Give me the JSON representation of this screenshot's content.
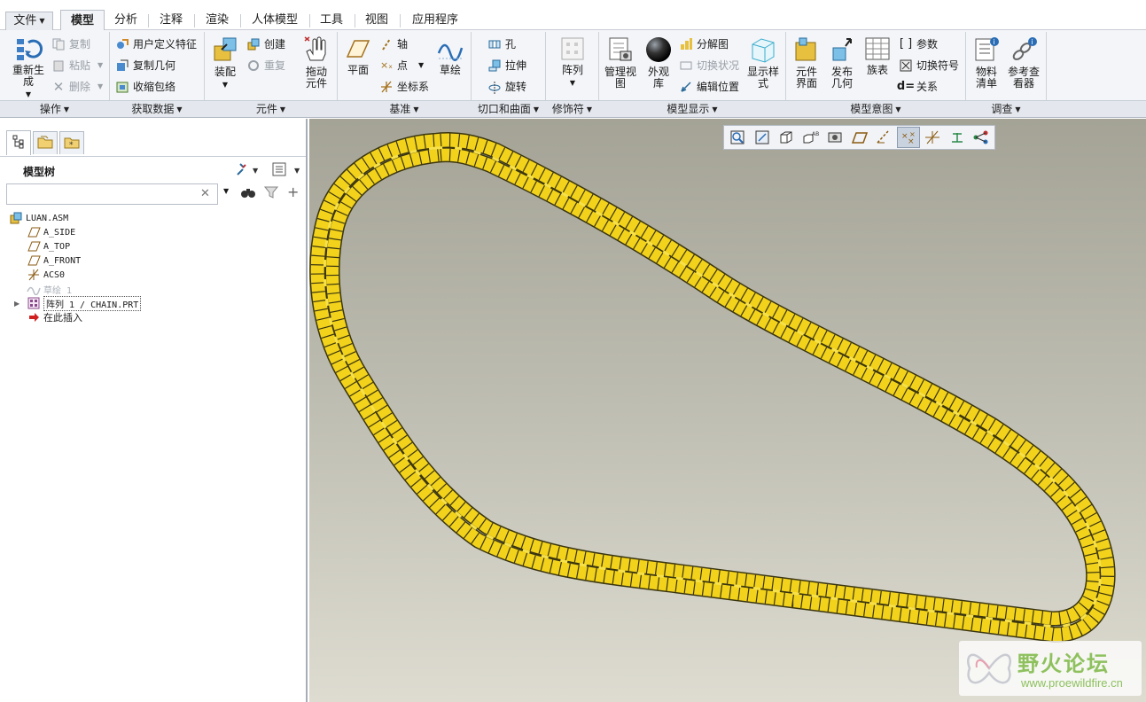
{
  "tabs": [
    {
      "label": "文件",
      "has_caret": true
    },
    {
      "label": "模型",
      "active": true
    },
    {
      "label": "分析"
    },
    {
      "label": "注释"
    },
    {
      "label": "渲染"
    },
    {
      "label": "人体模型"
    },
    {
      "label": "工具"
    },
    {
      "label": "视图"
    },
    {
      "label": "应用程序"
    }
  ],
  "ribbon": {
    "operations": {
      "regenerate": "重新生成",
      "copy": "复制",
      "paste": "粘贴",
      "delete": "删除",
      "group": "操作"
    },
    "get_data": {
      "udf": "用户定义特征",
      "copy_geom": "复制几何",
      "shrinkwrap": "收缩包络",
      "group": "获取数据"
    },
    "component": {
      "assemble": "装配",
      "create": "创建",
      "repeat": "重复",
      "drag": "拖动元件",
      "group": "元件"
    },
    "datum": {
      "plane": "平面",
      "axis": "轴",
      "point": "点",
      "csys": "坐标系",
      "sketch": "草绘",
      "group": "基准"
    },
    "cut_surface": {
      "hole": "孔",
      "extrude": "拉伸",
      "revolve": "旋转",
      "group": "切口和曲面"
    },
    "modifiers": {
      "pattern": "阵列",
      "group": "修饰符"
    },
    "model_display": {
      "manage_views": "管理视图",
      "appearance": "外观库",
      "explode": "分解图",
      "toggle_status": "切换状况",
      "edit_position": "编辑位置",
      "display_style": "显示样式",
      "group": "模型显示"
    },
    "model_intent": {
      "comp_interface": "元件界面",
      "publish_geom": "发布几何",
      "family_table": "族表",
      "parameters": "参数",
      "switch_symbols": "切换符号",
      "relations": "关系",
      "group": "模型意图"
    },
    "investigate": {
      "bom": "物料清单",
      "ref_viewer": "参考查看器",
      "group": "调查"
    }
  },
  "model_tree": {
    "title": "模型树",
    "search_value": "",
    "items": [
      {
        "label": "LUAN.ASM",
        "icon": "assembly-icon"
      },
      {
        "label": "A_SIDE",
        "icon": "datum-plane-icon"
      },
      {
        "label": "A_TOP",
        "icon": "datum-plane-icon"
      },
      {
        "label": "A_FRONT",
        "icon": "datum-plane-icon"
      },
      {
        "label": "ACS0",
        "icon": "csys-icon"
      },
      {
        "label": "草绘 1",
        "icon": "sketch-icon",
        "suppressed": true
      },
      {
        "label": "阵列 1 / CHAIN.PRT",
        "icon": "pattern-icon"
      },
      {
        "label": "在此插入",
        "icon": "insert-arrow-icon"
      }
    ]
  },
  "watermark": {
    "title": "野火论坛",
    "url": "www.proewildfire.cn"
  },
  "colors": {
    "chain": "#f2d21a",
    "chain_edge": "#3a3510",
    "accent": "#2f6fb8",
    "bg_top": "#a4a396",
    "bg_bottom": "#dedcd1"
  }
}
